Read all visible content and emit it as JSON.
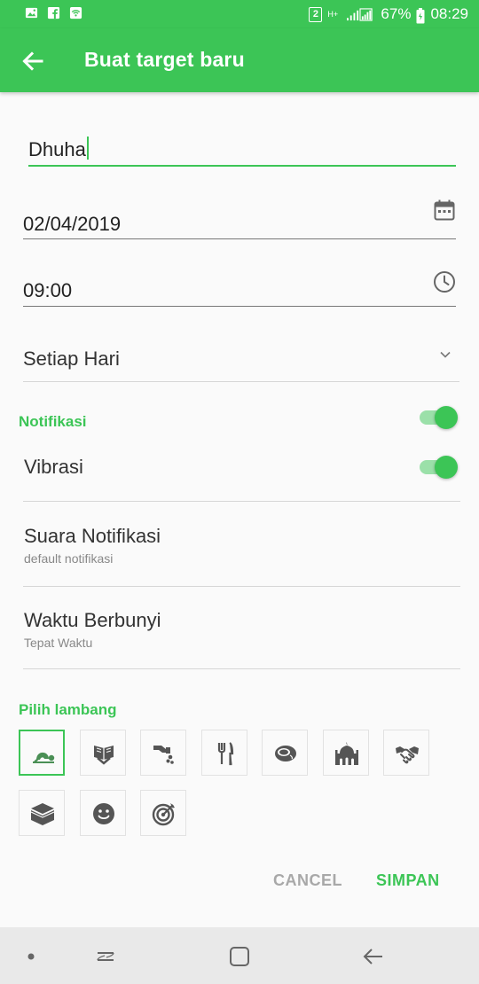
{
  "status_bar": {
    "sim_badge": "2",
    "network": "H+",
    "battery": "67%",
    "time": "08:29"
  },
  "app_bar": {
    "title": "Buat target baru"
  },
  "form": {
    "name_value": "Dhuha",
    "date_value": "02/04/2019",
    "time_value": "09:00",
    "repeat_value": "Setiap Hari"
  },
  "notifications": {
    "section_label": "Notifikasi",
    "section_enabled": true,
    "vibration_label": "Vibrasi",
    "vibration_enabled": true,
    "sound_label": "Suara Notifikasi",
    "sound_value": "default notifikasi",
    "ring_time_label": "Waktu Berbunyi",
    "ring_time_value": "Tepat Waktu"
  },
  "symbols": {
    "section_label": "Pilih lambang",
    "items": [
      {
        "icon": "prayer-icon",
        "selected": true
      },
      {
        "icon": "quran-icon",
        "selected": false
      },
      {
        "icon": "charity-icon",
        "selected": false
      },
      {
        "icon": "fork-knife-icon",
        "selected": false
      },
      {
        "icon": "meat-icon",
        "selected": false
      },
      {
        "icon": "mosque-icon",
        "selected": false
      },
      {
        "icon": "handshake-icon",
        "selected": false
      },
      {
        "icon": "kaaba-icon",
        "selected": false
      },
      {
        "icon": "smiley-icon",
        "selected": false
      },
      {
        "icon": "target-icon",
        "selected": false
      }
    ]
  },
  "actions": {
    "cancel_label": "CANCEL",
    "save_label": "SIMPAN"
  },
  "colors": {
    "accent": "#3cc556",
    "switch_track": "#9be0a9",
    "icon_gray": "#555555"
  }
}
